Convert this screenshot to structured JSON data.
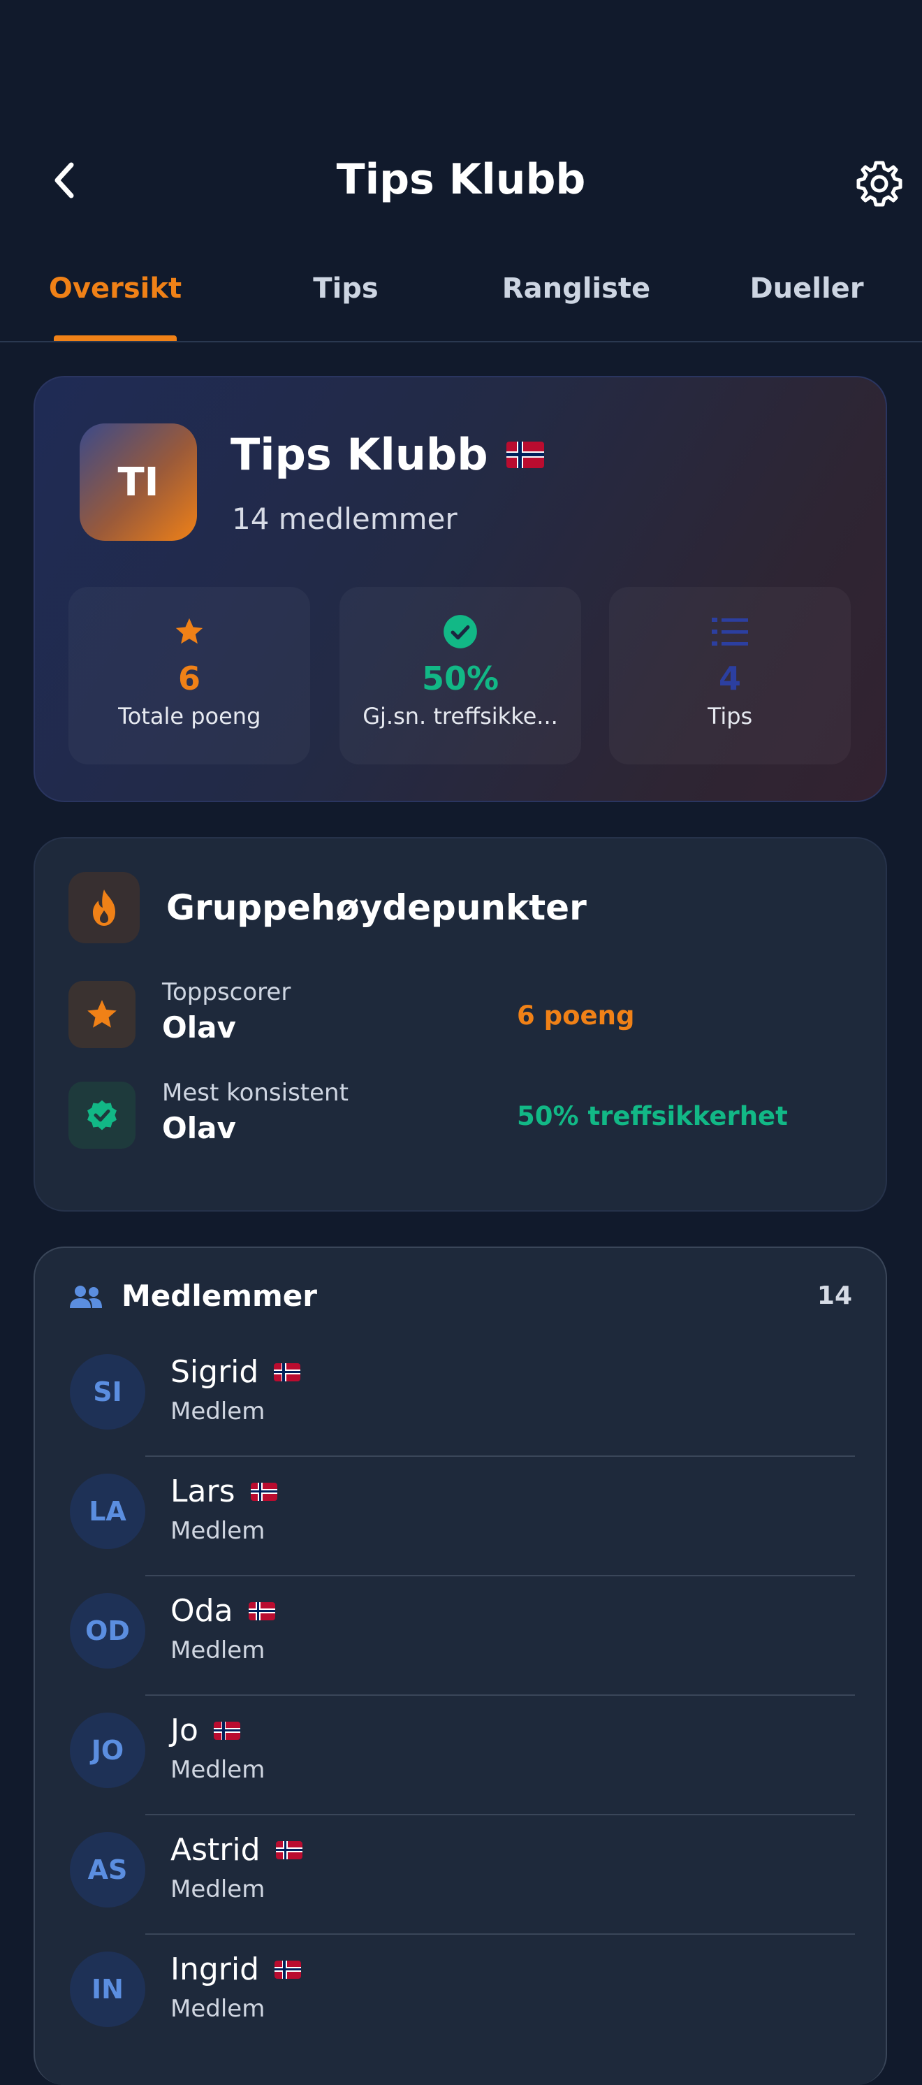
{
  "header": {
    "title": "Tips Klubb"
  },
  "tabs": [
    {
      "label": "Oversikt",
      "active": true
    },
    {
      "label": "Tips",
      "active": false
    },
    {
      "label": "Rangliste",
      "active": false
    },
    {
      "label": "Dueller",
      "active": false
    }
  ],
  "club": {
    "initials": "TI",
    "name": "Tips Klubb",
    "members_text": "14 medlemmer",
    "stats": [
      {
        "icon": "star-icon",
        "value": "6",
        "label": "Totale poeng",
        "color": "#f08117"
      },
      {
        "icon": "check-circle-icon",
        "value": "50%",
        "label": "Gj.sn. treffsikke...",
        "color": "#12b886"
      },
      {
        "icon": "list-icon",
        "value": "4",
        "label": "Tips",
        "color": "#2c3fa0"
      }
    ]
  },
  "highlights": {
    "title": "Gruppehøydepunkter",
    "rows": [
      {
        "icon": "star-icon",
        "label": "Toppscorer",
        "name": "Olav",
        "value": "6 poeng",
        "color": "#f08117"
      },
      {
        "icon": "verified-badge-icon",
        "label": "Mest konsistent",
        "name": "Olav",
        "value": "50% treffsikkerhet",
        "color": "#12b886"
      }
    ]
  },
  "members": {
    "title": "Medlemmer",
    "count": "14",
    "list": [
      {
        "initials": "SI",
        "name": "Sigrid",
        "role": "Medlem"
      },
      {
        "initials": "LA",
        "name": "Lars",
        "role": "Medlem"
      },
      {
        "initials": "OD",
        "name": "Oda",
        "role": "Medlem"
      },
      {
        "initials": "JO",
        "name": "Jo",
        "role": "Medlem"
      },
      {
        "initials": "AS",
        "name": "Astrid",
        "role": "Medlem"
      },
      {
        "initials": "IN",
        "name": "Ingrid",
        "role": "Medlem"
      }
    ]
  }
}
